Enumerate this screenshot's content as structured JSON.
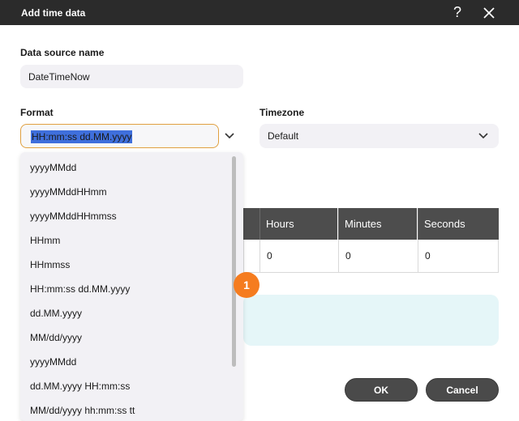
{
  "window": {
    "title": "Add time data",
    "help_icon": "?"
  },
  "data_source": {
    "label": "Data source name",
    "value": "DateTimeNow"
  },
  "format": {
    "label": "Format",
    "selected": "HH:mm:ss dd.MM.yyyy",
    "options": [
      "yyyyMMdd",
      "yyyyMMddHHmm",
      "yyyyMMddHHmmss",
      "HHmm",
      "HHmmss",
      "HH:mm:ss dd.MM.yyyy",
      "dd.MM.yyyy",
      "MM/dd/yyyy",
      "yyyyMMdd",
      "dd.MM.yyyy HH:mm:ss",
      "MM/dd/yyyy hh:mm:ss tt"
    ]
  },
  "timezone": {
    "label": "Timezone",
    "value": "Default"
  },
  "offset_table": {
    "headers": [
      "Hours",
      "Minutes",
      "Seconds"
    ],
    "values": [
      "0",
      "0",
      "0"
    ]
  },
  "badge": {
    "text": "1",
    "color": "#f57c1f"
  },
  "buttons": {
    "ok": "OK",
    "cancel": "Cancel"
  },
  "colors": {
    "titlebar": "#2b2b2b",
    "accent_orange": "#f57c1f",
    "selection": "#3f6fdc",
    "info_bg": "#e5f6f8"
  }
}
